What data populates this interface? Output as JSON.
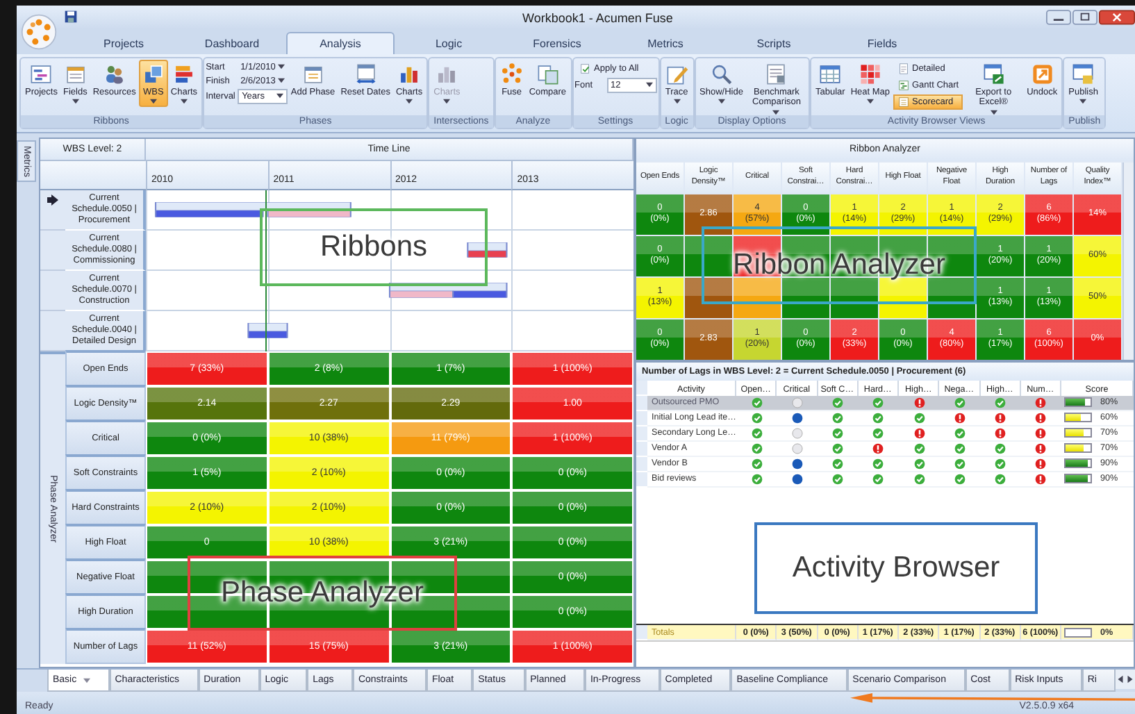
{
  "window": {
    "title": "Workbook1 - Acumen Fuse"
  },
  "menu_tabs": [
    {
      "label": "Projects",
      "selected": false
    },
    {
      "label": "Dashboard",
      "selected": false
    },
    {
      "label": "Analysis",
      "selected": true
    },
    {
      "label": "Logic",
      "selected": false
    },
    {
      "label": "Forensics",
      "selected": false
    },
    {
      "label": "Metrics",
      "selected": false
    },
    {
      "label": "Scripts",
      "selected": false
    },
    {
      "label": "Fields",
      "selected": false
    }
  ],
  "ribbon": {
    "groups": [
      {
        "label": "Ribbons",
        "items": [
          {
            "kind": "button",
            "label": "Projects",
            "dropdown": false,
            "selected": false,
            "disabled": false
          },
          {
            "kind": "button",
            "label": "Fields",
            "dropdown": true,
            "selected": false,
            "disabled": false
          },
          {
            "kind": "button",
            "label": "Resources",
            "dropdown": false,
            "selected": false,
            "disabled": false
          },
          {
            "kind": "button",
            "label": "WBS",
            "dropdown": true,
            "selected": true,
            "disabled": false
          },
          {
            "kind": "button",
            "label": "Charts",
            "dropdown": true,
            "selected": false,
            "disabled": false
          }
        ]
      },
      {
        "label": "Phases",
        "items": [
          {
            "kind": "field",
            "label": "Start",
            "value": "1/1/2010",
            "dropdown": true,
            "selected": false,
            "disabled": false
          },
          {
            "kind": "field",
            "label": "Finish",
            "value": "2/6/2013",
            "dropdown": true,
            "selected": false,
            "disabled": false
          },
          {
            "kind": "select",
            "label": "Interval",
            "value": "Years",
            "dropdown": true,
            "selected": false,
            "disabled": false
          },
          {
            "kind": "button",
            "label": "Add Phase",
            "dropdown": false,
            "selected": false,
            "disabled": false
          },
          {
            "kind": "button",
            "label": "Reset Dates",
            "dropdown": false,
            "selected": false,
            "disabled": false
          },
          {
            "kind": "button",
            "label": "Charts",
            "dropdown": true,
            "selected": false,
            "disabled": false
          }
        ]
      },
      {
        "label": "Intersections",
        "items": [
          {
            "kind": "button",
            "label": "Charts",
            "dropdown": true,
            "selected": false,
            "disabled": true
          }
        ]
      },
      {
        "label": "Analyze",
        "items": [
          {
            "kind": "button",
            "label": "Fuse",
            "dropdown": false,
            "selected": false,
            "disabled": false
          },
          {
            "kind": "button",
            "label": "Compare",
            "dropdown": false,
            "selected": false,
            "disabled": false
          }
        ]
      },
      {
        "label": "Settings",
        "items": [
          {
            "kind": "small",
            "label": "Apply to All",
            "dropdown": false,
            "selected": false,
            "disabled": false
          },
          {
            "kind": "select",
            "label": "Font",
            "value": "12",
            "dropdown": true,
            "selected": false,
            "disabled": false
          }
        ]
      },
      {
        "label": "Logic",
        "items": [
          {
            "kind": "button",
            "label": "Trace",
            "dropdown": true,
            "selected": false,
            "disabled": false
          }
        ]
      },
      {
        "label": "Display Options",
        "items": [
          {
            "kind": "button",
            "label": "Show/Hide",
            "dropdown": true,
            "selected": false,
            "disabled": false
          },
          {
            "kind": "button",
            "label": "Benchmark Comparison",
            "dropdown": true,
            "selected": false,
            "disabled": false
          }
        ]
      },
      {
        "label": "Activity Browser Views",
        "items": [
          {
            "kind": "button",
            "label": "Tabular",
            "dropdown": false,
            "selected": false,
            "disabled": false
          },
          {
            "kind": "button",
            "label": "Heat Map",
            "dropdown": true,
            "selected": false,
            "disabled": false
          },
          {
            "kind": "small",
            "label": "Detailed",
            "dropdown": false,
            "selected": false,
            "disabled": false
          },
          {
            "kind": "small",
            "label": "Gantt Chart",
            "dropdown": false,
            "selected": false,
            "disabled": false
          },
          {
            "kind": "small",
            "label": "Scorecard",
            "dropdown": false,
            "selected": true,
            "disabled": false
          },
          {
            "kind": "button",
            "label": "Export to Excel®",
            "dropdown": true,
            "selected": false,
            "disabled": false
          },
          {
            "kind": "button",
            "label": "Undock",
            "dropdown": false,
            "selected": false,
            "disabled": false
          }
        ]
      },
      {
        "label": "Publish",
        "items": [
          {
            "kind": "button",
            "label": "Publish",
            "dropdown": true,
            "selected": false,
            "disabled": false
          }
        ]
      }
    ]
  },
  "side_tab": "Metrics",
  "timeline": {
    "level_label": "WBS Level: 2",
    "title": "Time Line",
    "years": [
      "2010",
      "2011",
      "2012",
      "2013"
    ],
    "rows": [
      {
        "label": "Current Schedule.0050 | Procurement",
        "current": true
      },
      {
        "label": "Current Schedule.0080 | Commissioning",
        "current": false
      },
      {
        "label": "Current Schedule.0070 | Construction",
        "current": false
      },
      {
        "label": "Current Schedule.0040 | Detailed Design",
        "current": false
      }
    ]
  },
  "phase_analyzer": {
    "title": "Phase Analyzer",
    "rows": [
      {
        "label": "Open Ends",
        "cells": [
          {
            "text": "7 (33%)",
            "color": "#ee1c1c"
          },
          {
            "text": "2 (8%)",
            "color": "#0e870e"
          },
          {
            "text": "1 (7%)",
            "color": "#0e870e"
          },
          {
            "text": "1 (100%)",
            "color": "#ee1c1c"
          }
        ]
      },
      {
        "label": "Logic Density™",
        "cells": [
          {
            "text": "2.14",
            "color": "#56740c"
          },
          {
            "text": "2.27",
            "color": "#6f700c"
          },
          {
            "text": "2.29",
            "color": "#636a0c"
          },
          {
            "text": "1.00",
            "color": "#ee1c1c"
          }
        ]
      },
      {
        "label": "Critical",
        "cells": [
          {
            "text": "0 (0%)",
            "color": "#0e870e"
          },
          {
            "text": "10 (38%)",
            "color": "#f4f400"
          },
          {
            "text": "11 (79%)",
            "color": "#f59a10"
          },
          {
            "text": "1 (100%)",
            "color": "#ee1c1c"
          }
        ]
      },
      {
        "label": "Soft Constraints",
        "cells": [
          {
            "text": "1 (5%)",
            "color": "#0e870e"
          },
          {
            "text": "2 (10%)",
            "color": "#f4f400"
          },
          {
            "text": "0 (0%)",
            "color": "#0e870e"
          },
          {
            "text": "0 (0%)",
            "color": "#0e870e"
          }
        ]
      },
      {
        "label": "Hard Constraints",
        "cells": [
          {
            "text": "2 (10%)",
            "color": "#f4f400"
          },
          {
            "text": "2 (10%)",
            "color": "#f4f400"
          },
          {
            "text": "0 (0%)",
            "color": "#0e870e"
          },
          {
            "text": "0 (0%)",
            "color": "#0e870e"
          }
        ]
      },
      {
        "label": "High Float",
        "cells": [
          {
            "text": "0",
            "color": "#0e870e"
          },
          {
            "text": "10 (38%)",
            "color": "#f4f400"
          },
          {
            "text": "3 (21%)",
            "color": "#0e870e"
          },
          {
            "text": "0 (0%)",
            "color": "#0e870e"
          }
        ]
      },
      {
        "label": "Negative Float",
        "cells": [
          {
            "color": "#0e870e"
          },
          {
            "color": "#0e870e"
          },
          {
            "color": "#0e870e"
          },
          {
            "text": "0 (0%)",
            "color": "#0e870e"
          }
        ]
      },
      {
        "label": "High Duration",
        "cells": [
          {
            "color": "#0e870e"
          },
          {
            "color": "#0e870e"
          },
          {
            "color": "#0e870e"
          },
          {
            "text": "0 (0%)",
            "color": "#0e870e"
          }
        ]
      },
      {
        "label": "Number of Lags",
        "cells": [
          {
            "text": "11 (52%)",
            "color": "#ee1c1c"
          },
          {
            "text": "15 (75%)",
            "color": "#ee1c1c"
          },
          {
            "text": "3 (21%)",
            "color": "#0e870e"
          },
          {
            "text": "1 (100%)",
            "color": "#ee1c1c"
          }
        ]
      }
    ]
  },
  "ribbon_analyzer": {
    "title": "Ribbon Analyzer",
    "columns": [
      "Open Ends",
      "Logic Density™",
      "Critical",
      "Soft Constrai…",
      "Hard Constrai…",
      "High Float",
      "Negative Float",
      "High Duration",
      "Number of Lags",
      "Quality Index™"
    ],
    "rows": [
      {
        "cells": [
          {
            "value": "0",
            "share": "(0%)",
            "color": "#0e870e"
          },
          {
            "value": "2.86",
            "color": "#a0560e"
          },
          {
            "value": "4",
            "share": "(57%)",
            "color": "#f5a812"
          },
          {
            "value": "0",
            "share": "(0%)",
            "color": "#0e870e"
          },
          {
            "value": "1",
            "share": "(14%)",
            "color": "#f4f400"
          },
          {
            "value": "2",
            "share": "(29%)",
            "color": "#f4f400"
          },
          {
            "value": "1",
            "share": "(14%)",
            "color": "#f4f400"
          },
          {
            "value": "2",
            "share": "(29%)",
            "color": "#f4f400"
          },
          {
            "value": "6",
            "share": "(86%)",
            "color": "#ee1c1c"
          },
          {
            "value": "14%",
            "color": "#ee1c1c"
          }
        ]
      },
      {
        "cells": [
          {
            "value": "0",
            "share": "(0%)",
            "color": "#0e870e"
          },
          {
            "color": "#0e870e"
          },
          {
            "color": "#ee1c1c"
          },
          {
            "color": "#0e870e"
          },
          {
            "color": "#0e870e"
          },
          {
            "color": "#0e870e"
          },
          {
            "color": "#0e870e"
          },
          {
            "value": "1",
            "share": "(20%)",
            "color": "#0e870e"
          },
          {
            "value": "1",
            "share": "(20%)",
            "color": "#0e870e"
          },
          {
            "value": "60%",
            "color": "#f4f400"
          }
        ]
      },
      {
        "cells": [
          {
            "value": "1",
            "share": "(13%)",
            "color": "#f4f400"
          },
          {
            "color": "#a0560e"
          },
          {
            "color": "#f5a812"
          },
          {
            "color": "#0e870e"
          },
          {
            "color": "#0e870e"
          },
          {
            "color": "#f4f400"
          },
          {
            "color": "#0e870e"
          },
          {
            "value": "1",
            "share": "(13%)",
            "color": "#0e870e"
          },
          {
            "value": "1",
            "share": "(13%)",
            "color": "#0e870e"
          },
          {
            "value": "50%",
            "color": "#f4f400"
          }
        ]
      },
      {
        "cells": [
          {
            "value": "0",
            "share": "(0%)",
            "color": "#0e870e"
          },
          {
            "value": "2.83",
            "color": "#a0560e"
          },
          {
            "value": "1",
            "share": "(20%)",
            "color": "#c6d630"
          },
          {
            "value": "0",
            "share": "(0%)",
            "color": "#0e870e"
          },
          {
            "value": "2",
            "share": "(33%)",
            "color": "#ee1c1c"
          },
          {
            "value": "0",
            "share": "(0%)",
            "color": "#0e870e"
          },
          {
            "value": "4",
            "share": "(80%)",
            "color": "#ee1c1c"
          },
          {
            "value": "1",
            "share": "(17%)",
            "color": "#0e870e"
          },
          {
            "value": "6",
            "share": "(100%)",
            "color": "#ee1c1c"
          },
          {
            "value": "0%",
            "color": "#ee1c1c"
          }
        ]
      }
    ]
  },
  "activity_browser": {
    "title": "Number of Lags in WBS Level: 2 = Current Schedule.0050 | Procurement (6)",
    "columns": [
      "Activity",
      "Open…",
      "Critical",
      "Soft C…",
      "Hard…",
      "High…",
      "Nega…",
      "High…",
      "Num…",
      "Score"
    ],
    "rows": [
      {
        "name": "Outsourced PMO",
        "selected": true,
        "marks": [
          {
            "kind": "ok"
          },
          {
            "kind": "off"
          },
          {
            "kind": "ok"
          },
          {
            "kind": "ok"
          },
          {
            "kind": "alert"
          },
          {
            "kind": "ok"
          },
          {
            "kind": "ok"
          },
          {
            "kind": "alert"
          }
        ],
        "level": 0.8,
        "score": "80%"
      },
      {
        "name": "Initial Long Lead ite…",
        "selected": false,
        "marks": [
          {
            "kind": "ok"
          },
          {
            "kind": "on"
          },
          {
            "kind": "ok"
          },
          {
            "kind": "ok"
          },
          {
            "kind": "ok"
          },
          {
            "kind": "alert"
          },
          {
            "kind": "alert"
          },
          {
            "kind": "alert"
          }
        ],
        "level": 0.6,
        "score": "60%"
      },
      {
        "name": "Secondary Long Le…",
        "selected": false,
        "marks": [
          {
            "kind": "ok"
          },
          {
            "kind": "off"
          },
          {
            "kind": "ok"
          },
          {
            "kind": "ok"
          },
          {
            "kind": "alert"
          },
          {
            "kind": "ok"
          },
          {
            "kind": "alert"
          },
          {
            "kind": "alert"
          }
        ],
        "level": 0.7,
        "score": "70%"
      },
      {
        "name": "Vendor A",
        "selected": false,
        "marks": [
          {
            "kind": "ok"
          },
          {
            "kind": "off"
          },
          {
            "kind": "ok"
          },
          {
            "kind": "alert"
          },
          {
            "kind": "ok"
          },
          {
            "kind": "ok"
          },
          {
            "kind": "ok"
          },
          {
            "kind": "alert"
          }
        ],
        "level": 0.7,
        "score": "70%"
      },
      {
        "name": "Vendor B",
        "selected": false,
        "marks": [
          {
            "kind": "ok"
          },
          {
            "kind": "on"
          },
          {
            "kind": "ok"
          },
          {
            "kind": "ok"
          },
          {
            "kind": "ok"
          },
          {
            "kind": "ok"
          },
          {
            "kind": "ok"
          },
          {
            "kind": "alert"
          }
        ],
        "level": 0.9,
        "score": "90%"
      },
      {
        "name": "Bid reviews",
        "selected": false,
        "marks": [
          {
            "kind": "ok"
          },
          {
            "kind": "on"
          },
          {
            "kind": "ok"
          },
          {
            "kind": "ok"
          },
          {
            "kind": "ok"
          },
          {
            "kind": "ok"
          },
          {
            "kind": "ok"
          },
          {
            "kind": "alert"
          }
        ],
        "level": 0.9,
        "score": "90%"
      }
    ],
    "totals": {
      "label": "Totals",
      "cells": [
        "0 (0%)",
        "3 (50%)",
        "0 (0%)",
        "1 (17%)",
        "2 (33%)",
        "1 (17%)",
        "2 (33%)",
        "6 (100%)"
      ],
      "score": "0%"
    }
  },
  "bottom_tabs": [
    {
      "label": "Basic",
      "selected": true
    },
    {
      "label": "Characteristics",
      "selected": false
    },
    {
      "label": "Duration",
      "selected": false
    },
    {
      "label": "Logic",
      "selected": false
    },
    {
      "label": "Lags",
      "selected": false
    },
    {
      "label": "Constraints",
      "selected": false
    },
    {
      "label": "Float",
      "selected": false
    },
    {
      "label": "Status",
      "selected": false
    },
    {
      "label": "Planned",
      "selected": false
    },
    {
      "label": "In-Progress",
      "selected": false
    },
    {
      "label": "Completed",
      "selected": false
    },
    {
      "label": "Baseline Compliance",
      "selected": false
    },
    {
      "label": "Scenario Comparison",
      "selected": false
    },
    {
      "label": "Cost",
      "selected": false
    },
    {
      "label": "Risk Inputs",
      "selected": false
    },
    {
      "label": "Ri",
      "selected": false
    }
  ],
  "status_bar": {
    "left": "Ready",
    "right": "V2.5.0.9 x64"
  },
  "callouts": [
    {
      "text": "Ribbons",
      "color": "#5cb85c"
    },
    {
      "text": "Ribbon Analyzer",
      "color": "#3aa8c8"
    },
    {
      "text": "Phase Analyzer",
      "color": "#e04040"
    },
    {
      "text": "Activity Browser",
      "color": "#3a78c0"
    }
  ]
}
